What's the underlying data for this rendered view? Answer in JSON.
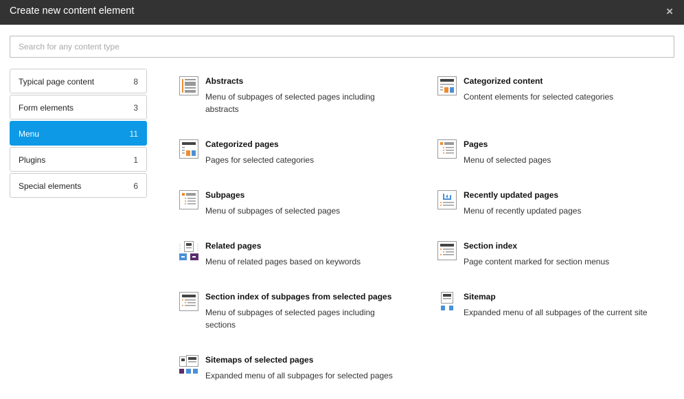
{
  "dialog": {
    "title": "Create new content element",
    "close_label": "×"
  },
  "search": {
    "placeholder": "Search for any content type",
    "value": ""
  },
  "categories": [
    {
      "label": "Typical page content",
      "count": "8"
    },
    {
      "label": "Form elements",
      "count": "3"
    },
    {
      "label": "Menu",
      "count": "11",
      "active": true
    },
    {
      "label": "Plugins",
      "count": "1"
    },
    {
      "label": "Special elements",
      "count": "6"
    }
  ],
  "items": [
    {
      "name": "Abstracts",
      "description": "Menu of subpages of selected pages including abstracts",
      "icon": "menu-abstract-icon"
    },
    {
      "name": "Categorized content",
      "description": "Content elements for selected categories",
      "icon": "menu-categorized-content-icon"
    },
    {
      "name": "Categorized pages",
      "description": "Pages for selected categories",
      "icon": "menu-categorized-pages-icon"
    },
    {
      "name": "Pages",
      "description": "Menu of selected pages",
      "icon": "menu-pages-icon"
    },
    {
      "name": "Subpages",
      "description": "Menu of subpages of selected pages",
      "icon": "menu-subpages-icon"
    },
    {
      "name": "Recently updated pages",
      "description": "Menu of recently updated pages",
      "icon": "menu-recently-updated-icon"
    },
    {
      "name": "Related pages",
      "description": "Menu of related pages based on keywords",
      "icon": "menu-related-pages-icon"
    },
    {
      "name": "Section index",
      "description": "Page content marked for section menus",
      "icon": "menu-section-index-icon"
    },
    {
      "name": "Section index of subpages from selected pages",
      "description": "Menu of subpages of selected pages including sections",
      "icon": "menu-section-index-subpages-icon"
    },
    {
      "name": "Sitemap",
      "description": "Expanded menu of all subpages of the current site",
      "icon": "sitemap-icon"
    },
    {
      "name": "Sitemaps of selected pages",
      "description": "Expanded menu of all subpages for selected pages",
      "icon": "sitemaps-selected-icon"
    }
  ]
}
